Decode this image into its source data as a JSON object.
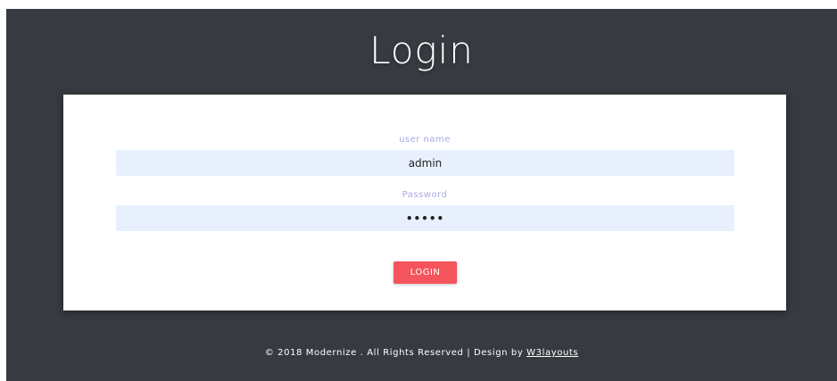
{
  "header": {
    "title": "Login"
  },
  "form": {
    "username_label": "user name",
    "username_value": "admin",
    "password_label": "Password",
    "password_value": "•••••",
    "login_button": "LOGIN"
  },
  "footer": {
    "copyright": "© 2018 Modernize . All Rights Reserved | Design by ",
    "link_text": "W3layouts"
  },
  "colors": {
    "background": "#373b41",
    "card": "#ffffff",
    "input_bg": "#e8f0fe",
    "label": "#a9a9e6",
    "button": "#f4545b"
  }
}
